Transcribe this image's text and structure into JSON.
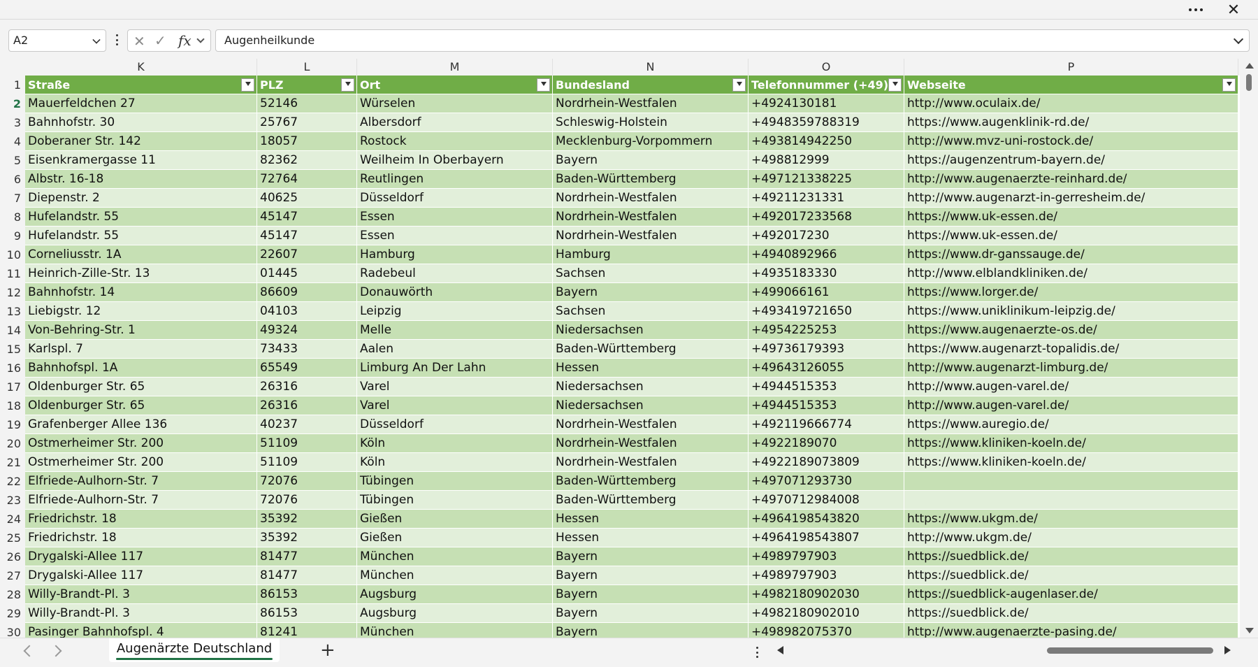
{
  "window": {
    "more_label": "•••",
    "close_label": "✕"
  },
  "formula_bar": {
    "name_box": "A2",
    "fx_label": "fx",
    "cancel_glyph": "✕",
    "enter_glyph": "✓",
    "formula": "Augenheilkunde"
  },
  "columns": [
    "K",
    "L",
    "M",
    "N",
    "O",
    "P"
  ],
  "headers": [
    "Straße",
    "PLZ",
    "Ort",
    "Bundesland",
    "Telefonnummer (+49)",
    "Webseite"
  ],
  "rows": [
    {
      "n": "2",
      "cells": [
        "Mauerfeldchen 27",
        "52146",
        "Würselen",
        "Nordrhein-Westfalen",
        "+4924130181",
        "http://www.oculaix.de/"
      ]
    },
    {
      "n": "3",
      "cells": [
        "Bahnhofstr. 30",
        "25767",
        "Albersdorf",
        "Schleswig-Holstein",
        "+4948359788319",
        "https://www.augenklinik-rd.de/"
      ]
    },
    {
      "n": "4",
      "cells": [
        "Doberaner Str. 142",
        "18057",
        "Rostock",
        "Mecklenburg-Vorpommern",
        "+493814942250",
        "http://www.mvz-uni-rostock.de/"
      ]
    },
    {
      "n": "5",
      "cells": [
        "Eisenkramergasse 11",
        "82362",
        "Weilheim In Oberbayern",
        "Bayern",
        "+498812999",
        "https://augenzentrum-bayern.de/"
      ]
    },
    {
      "n": "6",
      "cells": [
        "Albstr. 16-18",
        "72764",
        "Reutlingen",
        "Baden-Württemberg",
        "+497121338225",
        "http://www.augenaerzte-reinhard.de/"
      ]
    },
    {
      "n": "7",
      "cells": [
        "Diepenstr. 2",
        "40625",
        "Düsseldorf",
        "Nordrhein-Westfalen",
        "+49211231331",
        "http://www.augenarzt-in-gerresheim.de/"
      ]
    },
    {
      "n": "8",
      "cells": [
        "Hufelandstr. 55",
        "45147",
        "Essen",
        "Nordrhein-Westfalen",
        "+492017233568",
        "https://www.uk-essen.de/"
      ]
    },
    {
      "n": "9",
      "cells": [
        "Hufelandstr. 55",
        "45147",
        "Essen",
        "Nordrhein-Westfalen",
        "+492017230",
        "https://www.uk-essen.de/"
      ]
    },
    {
      "n": "10",
      "cells": [
        "Corneliusstr. 1A",
        "22607",
        "Hamburg",
        "Hamburg",
        "+4940892966",
        "https://www.dr-ganssauge.de/"
      ]
    },
    {
      "n": "11",
      "cells": [
        "Heinrich-Zille-Str. 13",
        "01445",
        "Radebeul",
        "Sachsen",
        "+4935183330",
        "http://www.elblandkliniken.de/"
      ]
    },
    {
      "n": "12",
      "cells": [
        "Bahnhofstr. 14",
        "86609",
        "Donauwörth",
        "Bayern",
        "+499066161",
        "https://www.lorger.de/"
      ]
    },
    {
      "n": "13",
      "cells": [
        "Liebigstr. 12",
        "04103",
        "Leipzig",
        "Sachsen",
        "+493419721650",
        "https://www.uniklinikum-leipzig.de/"
      ]
    },
    {
      "n": "14",
      "cells": [
        "Von-Behring-Str. 1",
        "49324",
        "Melle",
        "Niedersachsen",
        "+4954225253",
        "https://www.augenaerzte-os.de/"
      ]
    },
    {
      "n": "15",
      "cells": [
        "Karlspl. 7",
        "73433",
        "Aalen",
        "Baden-Württemberg",
        "+49736179393",
        "https://www.augenarzt-topalidis.de/"
      ]
    },
    {
      "n": "16",
      "cells": [
        "Bahnhofspl. 1A",
        "65549",
        "Limburg An Der Lahn",
        "Hessen",
        "+49643126055",
        "http://www.augenarzt-limburg.de/"
      ]
    },
    {
      "n": "17",
      "cells": [
        "Oldenburger Str. 65",
        "26316",
        "Varel",
        "Niedersachsen",
        "+4944515353",
        "http://www.augen-varel.de/"
      ]
    },
    {
      "n": "18",
      "cells": [
        "Oldenburger Str. 65",
        "26316",
        "Varel",
        "Niedersachsen",
        "+4944515353",
        "http://www.augen-varel.de/"
      ]
    },
    {
      "n": "19",
      "cells": [
        "Grafenberger Allee 136",
        "40237",
        "Düsseldorf",
        "Nordrhein-Westfalen",
        "+492119666774",
        "https://www.auregio.de/"
      ]
    },
    {
      "n": "20",
      "cells": [
        "Ostmerheimer Str. 200",
        "51109",
        "Köln",
        "Nordrhein-Westfalen",
        "+4922189070",
        "https://www.kliniken-koeln.de/"
      ]
    },
    {
      "n": "21",
      "cells": [
        "Ostmerheimer Str. 200",
        "51109",
        "Köln",
        "Nordrhein-Westfalen",
        "+4922189073809",
        "https://www.kliniken-koeln.de/"
      ]
    },
    {
      "n": "22",
      "cells": [
        "Elfriede-Aulhorn-Str. 7",
        "72076",
        "Tübingen",
        "Baden-Württemberg",
        "+497071293730",
        ""
      ]
    },
    {
      "n": "23",
      "cells": [
        "Elfriede-Aulhorn-Str. 7",
        "72076",
        "Tübingen",
        "Baden-Württemberg",
        "+4970712984008",
        ""
      ]
    },
    {
      "n": "24",
      "cells": [
        "Friedrichstr. 18",
        "35392",
        "Gießen",
        "Hessen",
        "+4964198543820",
        "https://www.ukgm.de/"
      ]
    },
    {
      "n": "25",
      "cells": [
        "Friedrichstr. 18",
        "35392",
        "Gießen",
        "Hessen",
        "+4964198543807",
        "http://www.ukgm.de/"
      ]
    },
    {
      "n": "26",
      "cells": [
        "Drygalski-Allee 117",
        "81477",
        "München",
        "Bayern",
        "+4989797903",
        "https://suedblick.de/"
      ]
    },
    {
      "n": "27",
      "cells": [
        "Drygalski-Allee 117",
        "81477",
        "München",
        "Bayern",
        "+4989797903",
        "https://suedblick.de/"
      ]
    },
    {
      "n": "28",
      "cells": [
        "Willy-Brandt-Pl. 3",
        "86153",
        "Augsburg",
        "Bayern",
        "+4982180902030",
        "https://suedblick-augenlaser.de/"
      ]
    },
    {
      "n": "29",
      "cells": [
        "Willy-Brandt-Pl. 3",
        "86153",
        "Augsburg",
        "Bayern",
        "+4982180902010",
        "https://suedblick.de/"
      ]
    },
    {
      "n": "30",
      "cells": [
        "Pasinger Bahnhofspl. 4",
        "81241",
        "München",
        "Bayern",
        "+498982075370",
        "http://www.augenaerzte-pasing.de/"
      ]
    }
  ],
  "sheet_tab": {
    "label": "Augenärzte Deutschland"
  },
  "add_sheet_label": "+",
  "colors": {
    "header": "#70ad47",
    "band_dark": "#c6e0b4",
    "band_light": "#e2efda",
    "accent": "#217346"
  }
}
